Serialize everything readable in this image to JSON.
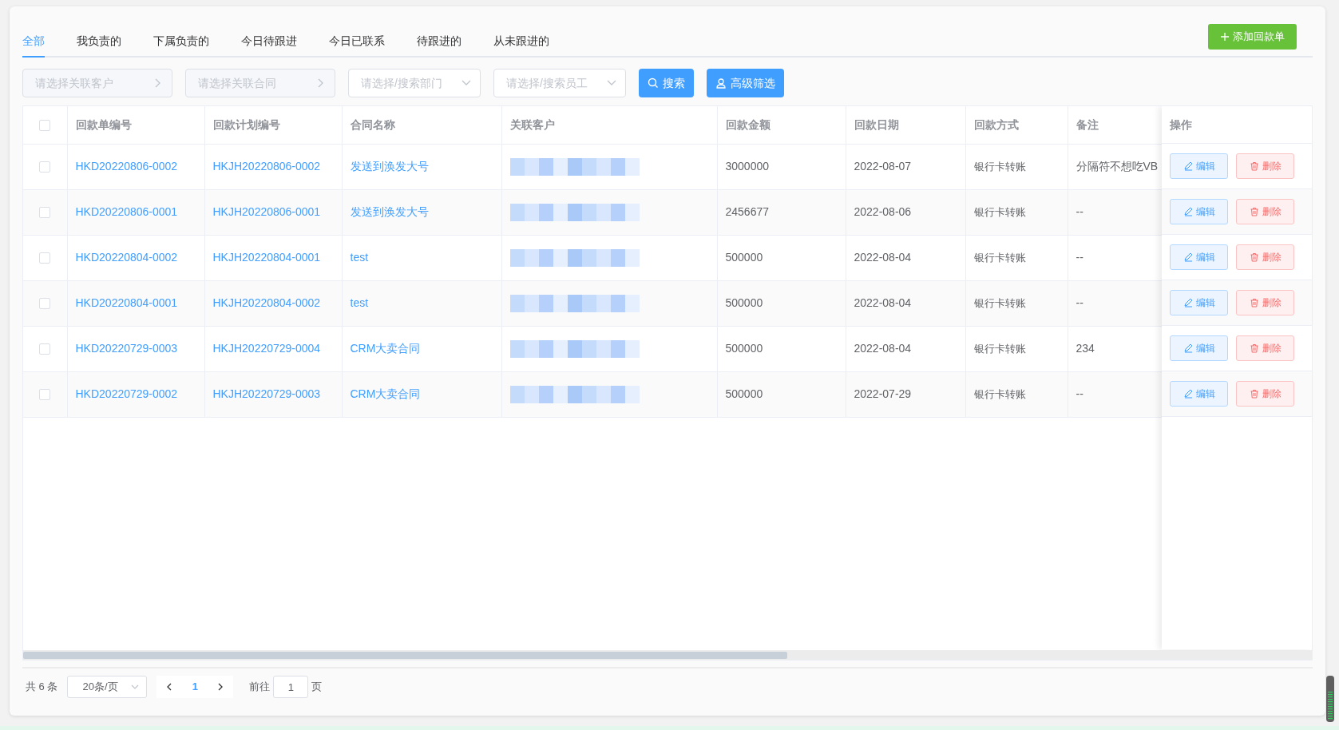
{
  "tabs": [
    {
      "label": "全部",
      "selected": true
    },
    {
      "label": "我负责的",
      "selected": false
    },
    {
      "label": "下属负责的",
      "selected": false
    },
    {
      "label": "今日待跟进",
      "selected": false
    },
    {
      "label": "今日已联系",
      "selected": false
    },
    {
      "label": "待跟进的",
      "selected": false
    },
    {
      "label": "从未跟进的",
      "selected": false
    }
  ],
  "add_button": {
    "label": "添加回款单"
  },
  "filters": [
    {
      "kind": "picker",
      "placeholder": "请选择关联客户"
    },
    {
      "kind": "picker",
      "placeholder": "请选择关联合同"
    },
    {
      "kind": "select",
      "placeholder": "请选择/搜索部门"
    },
    {
      "kind": "select",
      "placeholder": "请选择/搜索员工"
    }
  ],
  "search_button": {
    "label": "搜索"
  },
  "advanced_button": {
    "label": "高级筛选"
  },
  "table": {
    "header_checked": false,
    "columns": [
      "回款单编号",
      "回款计划编号",
      "合同名称",
      "关联客户",
      "回款金额",
      "回款日期",
      "回款方式",
      "备注",
      "操作"
    ],
    "rows": [
      {
        "checked": false,
        "number": "HKD20220806-0002",
        "plan": "HKJH20220806-0002",
        "contract": "发送到涣发大号",
        "amount": "3000000",
        "date": "2022-08-07",
        "method": "银行卡转账",
        "remark": "分隔符不想吃VB",
        "edit": "编辑",
        "delete": "删除"
      },
      {
        "checked": false,
        "number": "HKD20220806-0001",
        "plan": "HKJH20220806-0001",
        "contract": "发送到涣发大号",
        "amount": "2456677",
        "date": "2022-08-06",
        "method": "银行卡转账",
        "remark": "--",
        "edit": "编辑",
        "delete": "删除"
      },
      {
        "checked": false,
        "number": "HKD20220804-0002",
        "plan": "HKJH20220804-0001",
        "contract": "test",
        "amount": "500000",
        "date": "2022-08-04",
        "method": "银行卡转账",
        "remark": "--",
        "edit": "编辑",
        "delete": "删除"
      },
      {
        "checked": false,
        "number": "HKD20220804-0001",
        "plan": "HKJH20220804-0002",
        "contract": "test",
        "amount": "500000",
        "date": "2022-08-04",
        "method": "银行卡转账",
        "remark": "--",
        "edit": "编辑",
        "delete": "删除"
      },
      {
        "checked": false,
        "number": "HKD20220729-0003",
        "plan": "HKJH20220729-0004",
        "contract": "CRM大卖合同",
        "amount": "500000",
        "date": "2022-08-04",
        "method": "银行卡转账",
        "remark": "234",
        "edit": "编辑",
        "delete": "删除"
      },
      {
        "checked": false,
        "number": "HKD20220729-0002",
        "plan": "HKJH20220729-0003",
        "contract": "CRM大卖合同",
        "amount": "500000",
        "date": "2022-07-29",
        "method": "银行卡转账",
        "remark": "--",
        "edit": "编辑",
        "delete": "删除"
      }
    ]
  },
  "pagination": {
    "total": "共 6 条",
    "page_size": "20条/页",
    "current_page": "1",
    "goto_label": "前往",
    "goto_value": "1",
    "page_suffix": "页"
  }
}
